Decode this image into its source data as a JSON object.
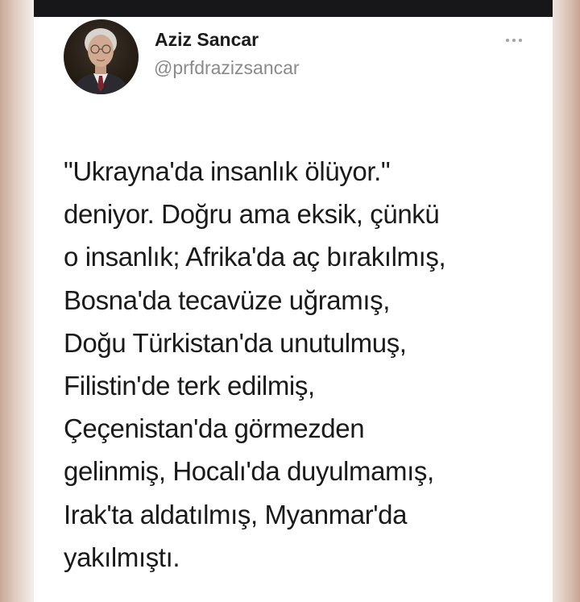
{
  "author": {
    "name": "Aziz Sancar",
    "handle": "@prfdrazizsancar",
    "avatar_icon": "profile-photo"
  },
  "more_icon": "ellipsis-icon",
  "tweet": {
    "lines": [
      "\"Ukrayna'da insanlık ölüyor.\"",
      "deniyor. Doğru ama eksik, çünkü",
      "o insanlık; Afrika'da aç bırakılmış,",
      "Bosna'da tecavüze uğramış,",
      "Doğu Türkistan'da unutulmuş,",
      "Filistin'de terk edilmiş,",
      "Çeçenistan'da görmezden",
      "gelinmiş, Hocalı'da duyulmamış,",
      "Irak'ta aldatılmış, Myanmar'da",
      "yakılmıştı."
    ]
  },
  "colors": {
    "background": "#f2ebe7",
    "card": "#ffffff",
    "top_bar": "#17171a",
    "text": "#1a1a1a",
    "handle": "#8a8a8a"
  }
}
